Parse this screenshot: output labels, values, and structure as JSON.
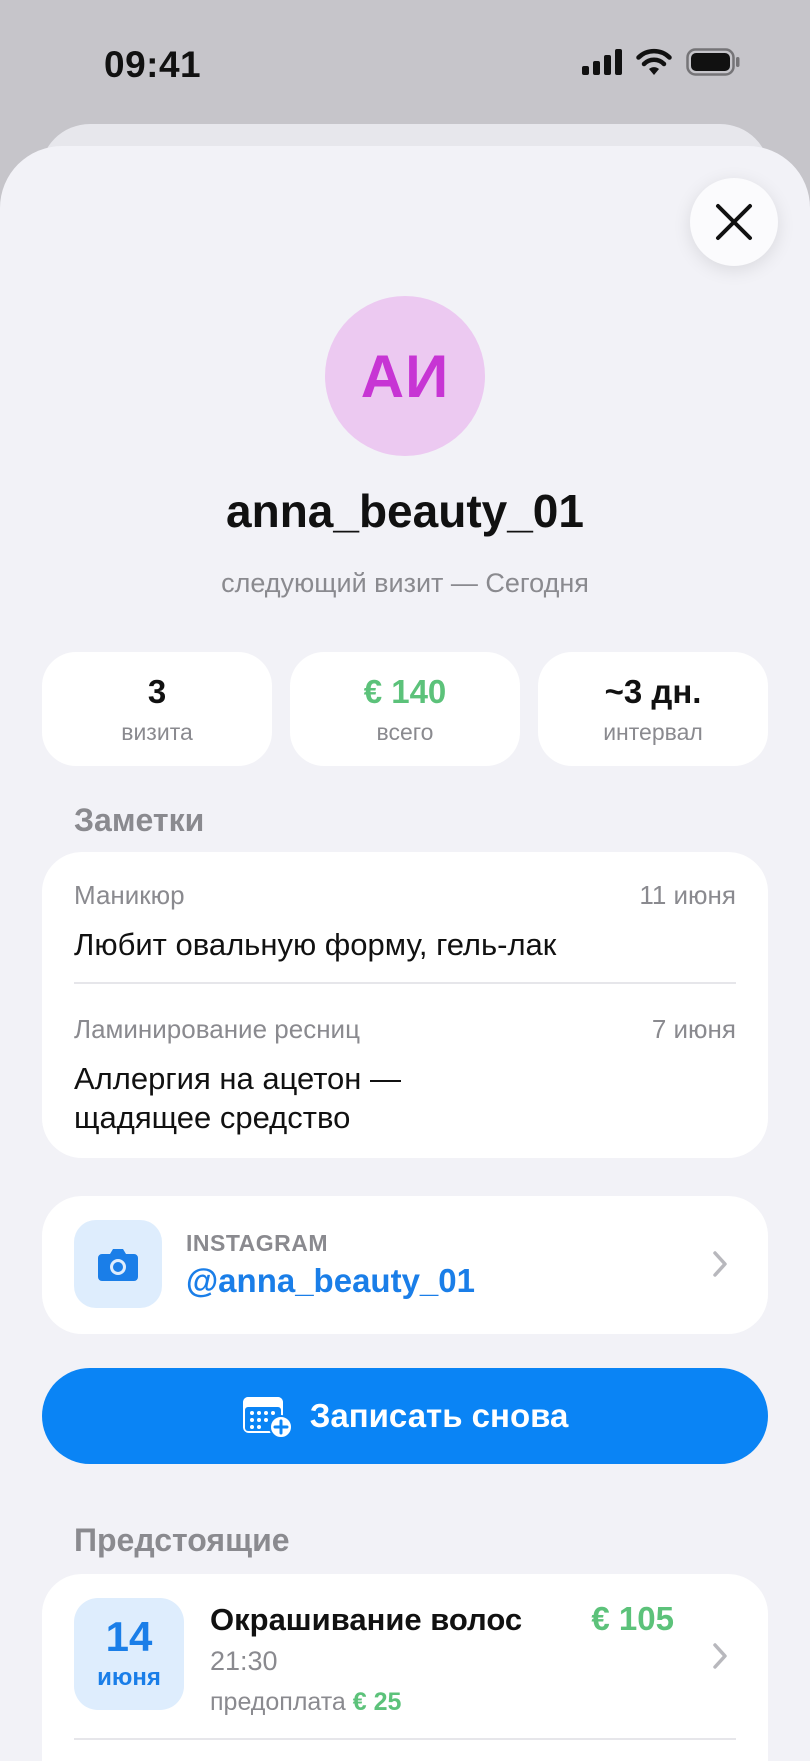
{
  "status_bar": {
    "time": "09:41"
  },
  "client": {
    "initials": "АИ",
    "username": "anna_beauty_01",
    "next_visit": "следующий визит — Сегодня"
  },
  "stats": [
    {
      "value": "3",
      "label": "визита"
    },
    {
      "value": "€ 140",
      "label": "всего"
    },
    {
      "value": "~3 дн.",
      "label": "интервал"
    }
  ],
  "notes": {
    "title": "Заметки",
    "items": [
      {
        "category": "Маникюр",
        "date": "11 июня",
        "text": "Любит овальную форму, гель-лак"
      },
      {
        "category": "Ламинирование ресниц",
        "date": "7 июня",
        "text": "Аллергия на ацетон — щадящее средство"
      }
    ]
  },
  "instagram": {
    "label": "INSTAGRAM",
    "handle": "@anna_beauty_01"
  },
  "cta": {
    "label": "Записать снова"
  },
  "upcoming": {
    "title": "Предстоящие",
    "items": [
      {
        "day": "14",
        "month": "июня",
        "service": "Окрашивание волос",
        "time": "21:30",
        "prepay_label": "предоплата",
        "prepay_amount": "€ 25",
        "price": "€ 105"
      }
    ]
  },
  "colors": {
    "accent": "#0a84f5",
    "green": "#5cc27a",
    "avatar_bg": "#ecc9f1",
    "avatar_text": "#c735d4"
  },
  "icons": [
    "cellular-icon",
    "wifi-icon",
    "battery-icon",
    "close-icon",
    "camera-icon",
    "calendar-add-icon",
    "chevron-right-icon"
  ]
}
